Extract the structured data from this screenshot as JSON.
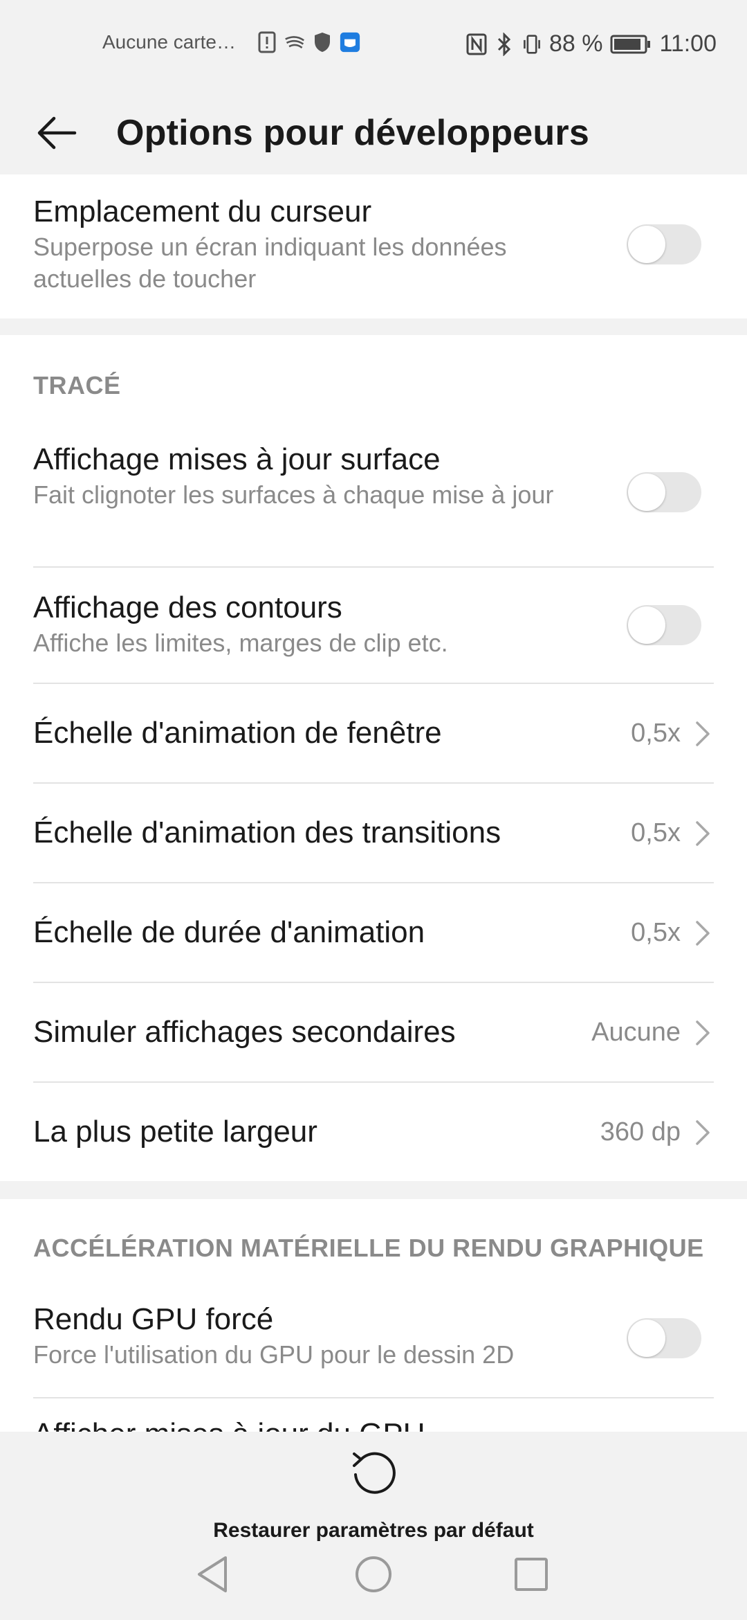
{
  "status_bar": {
    "carrier": "Aucune carte…",
    "battery_percent": "88 %",
    "time": "11:00",
    "left_icons": [
      "sim-alert-icon",
      "swiftkey-icon",
      "shield-icon",
      "app-notification-icon"
    ],
    "right_icons": [
      "nfc-icon",
      "bluetooth-icon",
      "vibrate-icon",
      "battery-icon"
    ]
  },
  "app_bar": {
    "title": "Options pour développeurs",
    "back_icon": "arrow-left-icon"
  },
  "top_item": {
    "title": "Emplacement du curseur",
    "subtitle": "Superpose un écran indiquant les données actuelles de toucher",
    "enabled": false
  },
  "section_trace": {
    "header": "TRACÉ",
    "toggle_items": [
      {
        "title": "Affichage mises à jour surface",
        "subtitle": "Fait clignoter les surfaces à chaque mise à jour",
        "enabled": false
      },
      {
        "title": "Affichage des contours",
        "subtitle": "Affiche les limites, marges de clip etc.",
        "enabled": false
      }
    ],
    "nav_items": [
      {
        "title": "Échelle d'animation de fenêtre",
        "value": "0,5x"
      },
      {
        "title": "Échelle d'animation des transitions",
        "value": "0,5x"
      },
      {
        "title": "Échelle de durée d'animation",
        "value": "0,5x"
      },
      {
        "title": "Simuler affichages secondaires",
        "value": "Aucune"
      },
      {
        "title": "La plus petite largeur",
        "value": "360 dp"
      }
    ]
  },
  "section_accel": {
    "header": "ACCÉLÉRATION MATÉRIELLE DU RENDU GRAPHIQUE",
    "items": [
      {
        "title": "Rendu GPU forcé",
        "subtitle": "Force l'utilisation du GPU pour le dessin 2D",
        "enabled": false
      },
      {
        "title": "Afficher mises à jour du GPU"
      }
    ]
  },
  "bottom": {
    "restore_label": "Restaurer paramètres par défaut",
    "restore_icon": "refresh-icon"
  },
  "nav_bar": {
    "icons": [
      "nav-back-icon",
      "nav-home-icon",
      "nav-recents-icon"
    ]
  },
  "colors": {
    "background": "#f2f2f2",
    "card": "#ffffff",
    "primary_text": "#1a1a1a",
    "secondary_text": "#8a8a8a",
    "toggle_off": "#e6e6e6"
  }
}
